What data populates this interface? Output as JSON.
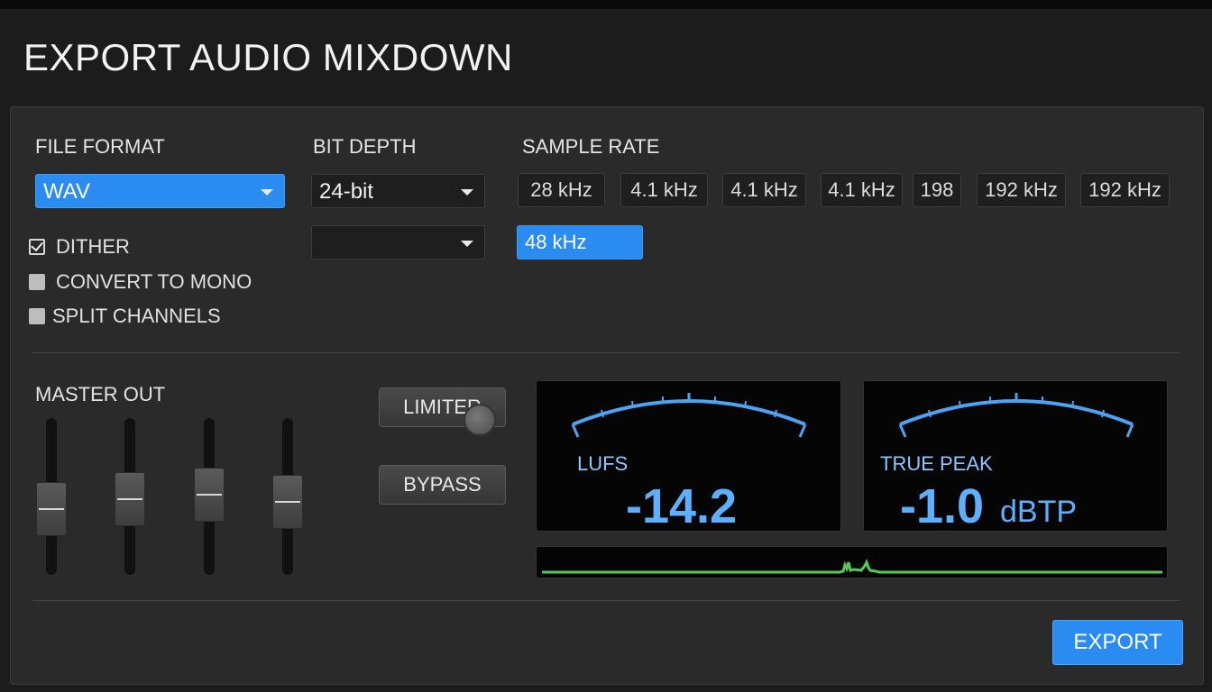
{
  "window": {
    "title": "EXPORT AUDIO MIXDOWN"
  },
  "format": {
    "label": "FILE FORMAT",
    "selected": "WAV",
    "options": [
      {
        "label": "DITHER",
        "checked": true
      },
      {
        "label": "CONVERT TO MONO",
        "checked": false
      },
      {
        "label": "SPLIT CHANNELS",
        "checked": false
      }
    ]
  },
  "bit_depth": {
    "label": "BIT DEPTH",
    "selected": "24-bit",
    "secondary": ""
  },
  "sample_rate": {
    "label": "SAMPLE RATE",
    "chips": [
      "28 kHz",
      "4.1 kHz",
      "4.1 kHz",
      "4.1 kHz",
      "198",
      "192 kHz",
      "192 kHz"
    ],
    "selected": "48 kHz"
  },
  "master": {
    "label": "MASTER OUT",
    "fader_levels": [
      0.38,
      0.47,
      0.52,
      0.45
    ],
    "limiter_label": "LIMITER",
    "bypass_label": "BYPASS"
  },
  "meters": {
    "lufs": {
      "label": "LUFS",
      "value": "-14.2"
    },
    "true_peak": {
      "label": "TRUE PEAK",
      "value": "-1.0",
      "unit": "dBTP"
    }
  },
  "colors": {
    "accent": "#2a8cf0",
    "meter": "#5cb0ff",
    "wave": "#55c85a"
  },
  "actions": {
    "export_label": "EXPORT"
  }
}
